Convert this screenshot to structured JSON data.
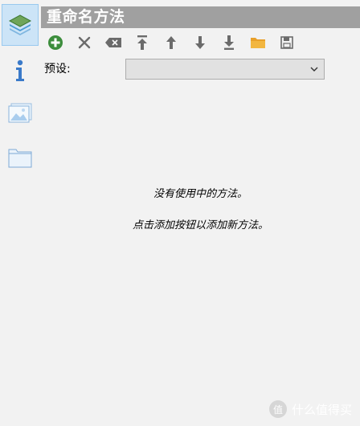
{
  "panel": {
    "title": "重命名方法"
  },
  "sidebar": {
    "items": [
      {
        "icon": "layers-icon",
        "selected": true
      },
      {
        "icon": "info-icon",
        "selected": false
      },
      {
        "icon": "images-icon",
        "selected": false
      },
      {
        "icon": "folder-icon",
        "selected": false
      }
    ]
  },
  "toolbar": {
    "buttons": [
      {
        "name": "add-button",
        "icon": "add-icon"
      },
      {
        "name": "remove-button",
        "icon": "close-icon"
      },
      {
        "name": "clear-button",
        "icon": "backspace-icon"
      },
      {
        "name": "move-top-button",
        "icon": "arrow-top-icon"
      },
      {
        "name": "move-up-button",
        "icon": "arrow-up-icon"
      },
      {
        "name": "move-down-button",
        "icon": "arrow-down-icon"
      },
      {
        "name": "move-bottom-button",
        "icon": "arrow-bottom-icon"
      },
      {
        "name": "open-button",
        "icon": "folder-open-icon"
      },
      {
        "name": "save-button",
        "icon": "save-icon"
      }
    ]
  },
  "preset": {
    "label": "预设:",
    "value": ""
  },
  "empty": {
    "line1": "没有使用中的方法。",
    "line2": "点击添加按钮以添加新方法。"
  },
  "watermark": {
    "text": "什么值得买",
    "badge": "值"
  },
  "colors": {
    "titlebar": "#a0a0a0",
    "add_green": "#3c8d3c",
    "folder_orange": "#e8a02a",
    "icon_gray": "#6b6b6b",
    "selected_bg": "#cce4f7"
  }
}
